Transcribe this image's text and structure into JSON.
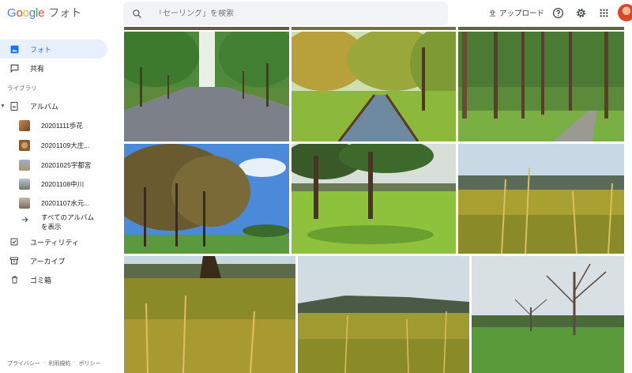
{
  "app": {
    "logo_text": "Google",
    "product": "フォト"
  },
  "search": {
    "placeholder": "「セーリング」を検索"
  },
  "toolbar": {
    "upload_label": "アップロード"
  },
  "sidebar": {
    "photos_label": "フォト",
    "shared_label": "共有",
    "library_label": "ライブラリ",
    "albums_label": "アルバム",
    "albums": [
      {
        "name": "20201111歩花"
      },
      {
        "name": "20201109大庄..."
      },
      {
        "name": "20201025宇都宮"
      },
      {
        "name": "20201108中川"
      },
      {
        "name": "20201107水元..."
      }
    ],
    "show_all_line1": "すべてのアルバム",
    "show_all_line2": "を表示",
    "utilities_label": "ユーティリティ",
    "archive_label": "アーカイブ",
    "trash_label": "ゴミ箱"
  },
  "footer": {
    "privacy": "プライバシー",
    "terms": "利用規約",
    "policy": "ポリシー",
    "separator": "·"
  },
  "colors": {
    "accent": "#1a73e8",
    "active_bg": "#e8f0fe"
  }
}
